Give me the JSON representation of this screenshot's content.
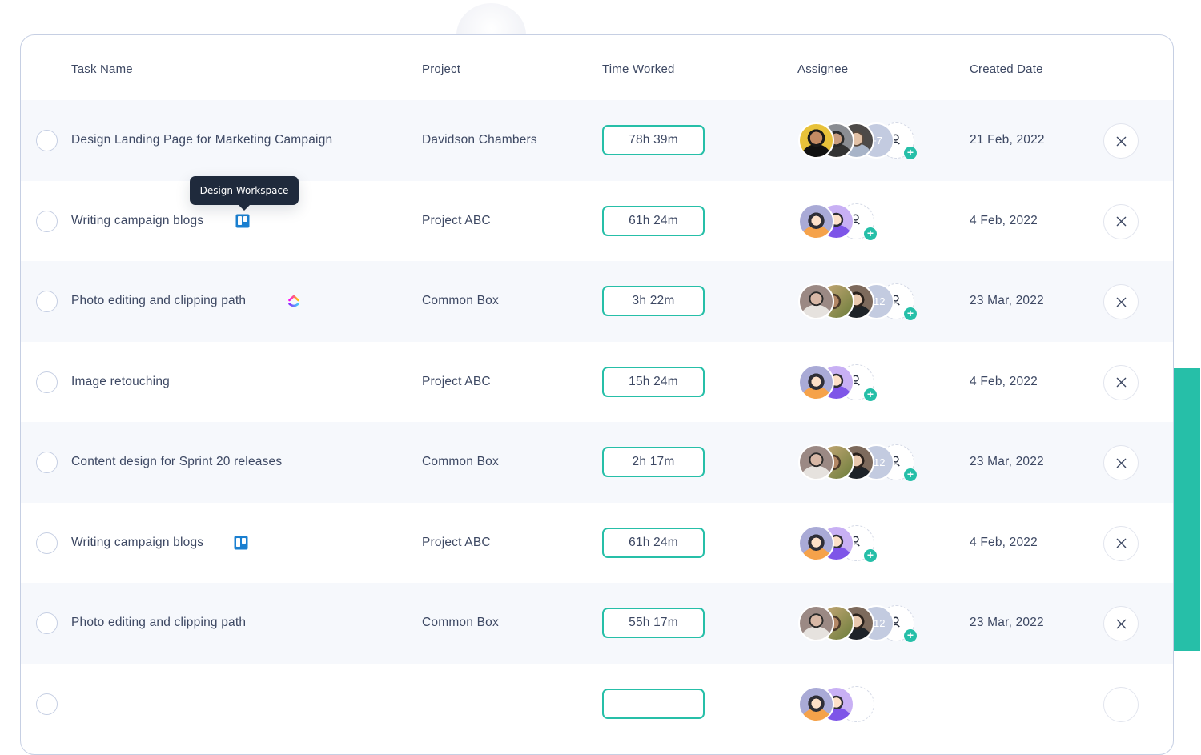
{
  "table": {
    "columns": [
      "Task Name",
      "Project",
      "Time Worked",
      "Assignee",
      "Created Date"
    ],
    "rows": [
      {
        "task": "Design Landing Page for Marketing Campaign",
        "integration_icon": "",
        "project": "Davidson Chambers",
        "time_worked": "78h 39m",
        "assignees": [
          "avatar-man-yellow",
          "avatar-man-dark",
          "avatar-man-glasses"
        ],
        "more_count": "+7",
        "created_date": "21 Feb, 2022"
      },
      {
        "task": "Writing campaign blogs",
        "integration_icon": "trello-icon",
        "project": "Project ABC",
        "time_worked": "61h 24m",
        "assignees": [
          "avatar-woman-illustration",
          "avatar-man-illustration"
        ],
        "more_count": "",
        "created_date": "4 Feb, 2022"
      },
      {
        "task": "Photo editing and clipping path",
        "integration_icon": "clickup-icon",
        "project": "Common Box",
        "time_worked": "3h 22m",
        "assignees": [
          "avatar-man-glasses-photo",
          "avatar-person-outdoor",
          "avatar-man-dark-hair"
        ],
        "more_count": "+12",
        "created_date": "23 Mar, 2022"
      },
      {
        "task": "Image retouching",
        "integration_icon": "",
        "project": "Project ABC",
        "time_worked": "15h 24m",
        "assignees": [
          "avatar-woman-illustration",
          "avatar-man-illustration"
        ],
        "more_count": "",
        "created_date": "4 Feb, 2022"
      },
      {
        "task": "Content design for Sprint 20 releases",
        "integration_icon": "",
        "project": "Common Box",
        "time_worked": "2h 17m",
        "assignees": [
          "avatar-man-glasses-photo",
          "avatar-person-outdoor",
          "avatar-man-dark-hair"
        ],
        "more_count": "+12",
        "created_date": "23 Mar, 2022"
      },
      {
        "task": "Writing campaign blogs",
        "integration_icon": "trello-icon",
        "project": "Project ABC",
        "time_worked": "61h 24m",
        "assignees": [
          "avatar-woman-illustration",
          "avatar-man-illustration"
        ],
        "more_count": "",
        "created_date": "4 Feb, 2022"
      },
      {
        "task": "Photo editing and clipping path",
        "integration_icon": "",
        "project": "Common Box",
        "time_worked": "55h 17m",
        "assignees": [
          "avatar-man-glasses-photo",
          "avatar-person-outdoor",
          "avatar-man-dark-hair"
        ],
        "more_count": "+12",
        "created_date": "23 Mar, 2022"
      }
    ]
  },
  "tooltip": {
    "text": "Design Workspace"
  },
  "colors": {
    "accent": "#26bfa8",
    "text": "#3d4863",
    "tooltip_bg": "#1f2a3c",
    "row_alt": "#f6f8fc",
    "more_badge": "#c3cbe0"
  }
}
